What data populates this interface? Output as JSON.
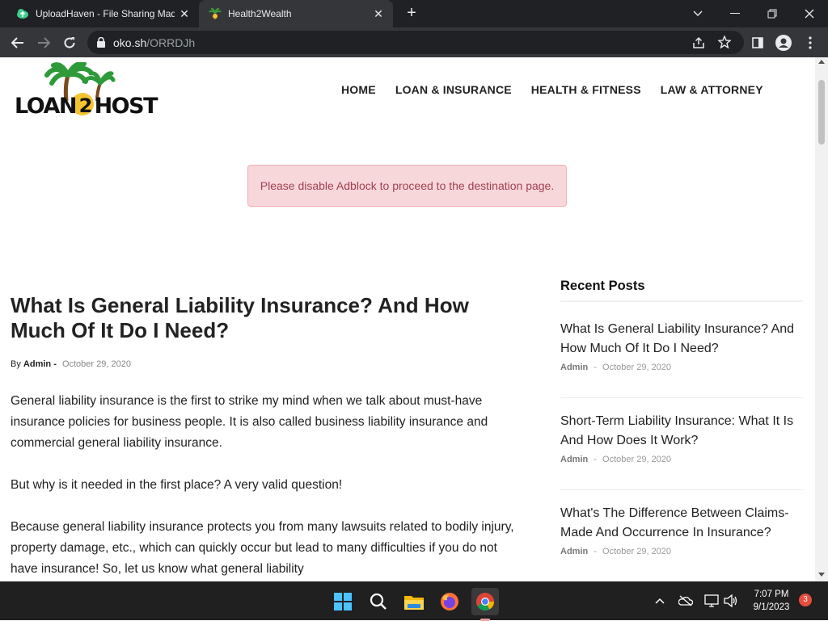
{
  "browser": {
    "tabs": [
      {
        "title": "UploadHaven - File Sharing Made Simple",
        "close": "✕"
      },
      {
        "title": "Health2Wealth",
        "close": "✕"
      }
    ],
    "new_tab": "+",
    "url": {
      "host": "oko.sh",
      "path": "/ORRDJh"
    }
  },
  "site": {
    "logo_text_left": "LOAN",
    "logo_text_mid": "2",
    "logo_text_right": "HOST",
    "nav": [
      "HOME",
      "LOAN & INSURANCE",
      "HEALTH & FITNESS",
      "LAW & ATTORNEY"
    ]
  },
  "alert": "Please disable Adblock to proceed to the destination page.",
  "article": {
    "title": "What Is General Liability Insurance? And How Much Of It Do I Need?",
    "by": "By",
    "author": "Admin",
    "dash": "-",
    "date": "October 29, 2020",
    "paragraphs": [
      "General liability insurance is the first to strike my mind when we talk about must-have insurance policies for business people. It is also called business liability insurance and commercial general liability insurance.",
      "But why is it needed in the first place? A very valid question!",
      "Because general liability insurance protects you from many lawsuits related to bodily injury, property damage, etc., which can quickly occur but lead to many difficulties if you do not have insurance! So, let us know what general liability"
    ]
  },
  "sidebar": {
    "title": "Recent Posts",
    "posts": [
      {
        "title": "What Is General Liability Insurance? And How Much Of It Do I Need?",
        "author": "Admin",
        "dash": "-",
        "date": "October 29, 2020"
      },
      {
        "title": "Short-Term Liability Insurance: What It Is And How Does It Work?",
        "author": "Admin",
        "dash": "-",
        "date": "October 29, 2020"
      },
      {
        "title": "What's The Difference Between Claims-Made And Occurrence In Insurance?",
        "author": "Admin",
        "dash": "-",
        "date": "October 29, 2020"
      }
    ]
  },
  "taskbar": {
    "time": "7:07 PM",
    "date": "9/1/2023",
    "notifications": "3"
  },
  "colors": {
    "alert_bg": "#f8d7da",
    "alert_text": "#a04050",
    "taskbar": "#202020",
    "browser_dark": "#202124"
  }
}
